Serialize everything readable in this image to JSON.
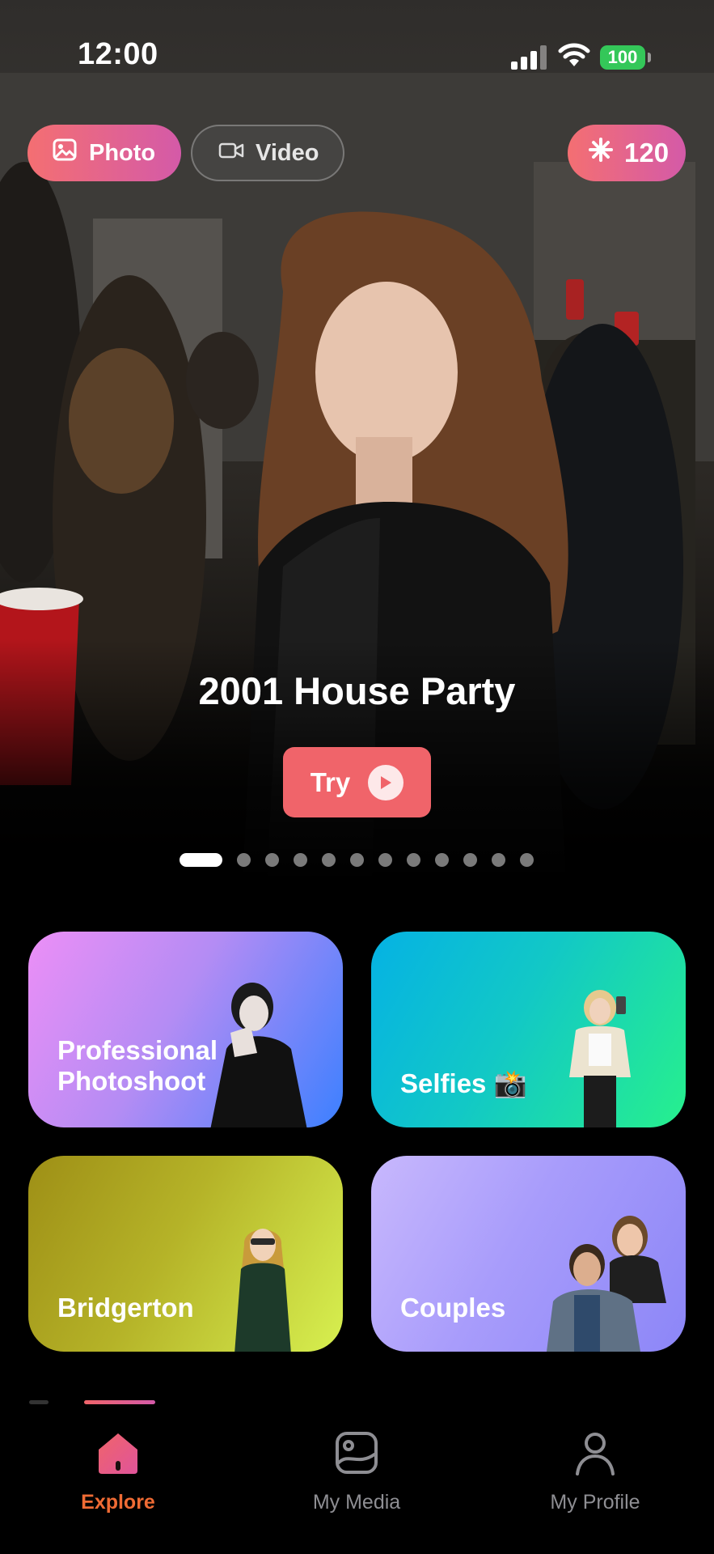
{
  "status_bar": {
    "time": "12:00",
    "battery": "100"
  },
  "mode_toggle": {
    "photo_label": "Photo",
    "video_label": "Video",
    "selected": "Photo"
  },
  "credits": {
    "count": "120",
    "icon": "sparkle-icon"
  },
  "hero": {
    "title": "2001 House Party",
    "try_label": "Try",
    "slide_count": 12,
    "active_slide": 1
  },
  "categories": [
    {
      "label": "Professional Photoshoot"
    },
    {
      "label": "Selfies 📸"
    },
    {
      "label": "Bridgerton"
    },
    {
      "label": "Couples"
    }
  ],
  "tabs": [
    {
      "label": "Explore",
      "icon": "home-icon",
      "active": true
    },
    {
      "label": "My Media",
      "icon": "gallery-icon",
      "active": false
    },
    {
      "label": "My Profile",
      "icon": "profile-icon",
      "active": false
    }
  ],
  "colors": {
    "accent": "#f0646a",
    "active_tab": "#ef6b34",
    "battery": "#34c759"
  }
}
